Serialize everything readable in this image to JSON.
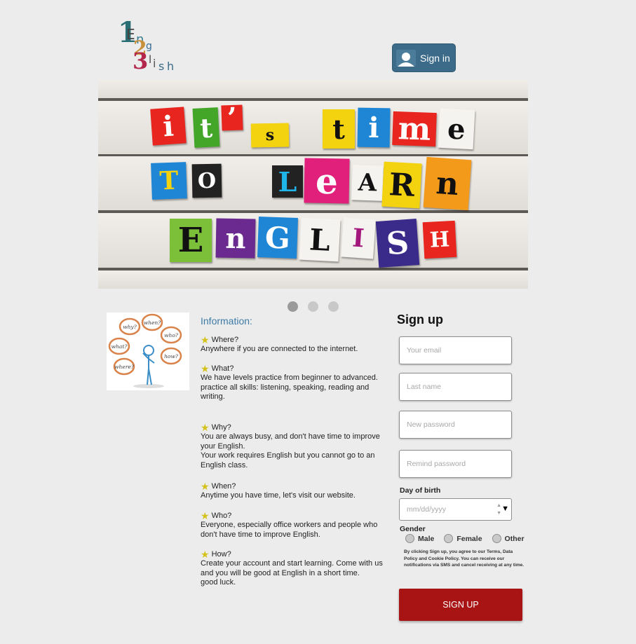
{
  "logo": {
    "alt_glyphs": [
      "1",
      "2",
      "3"
    ],
    "word": "English"
  },
  "header": {
    "signin_label": "Sign in"
  },
  "banner": {
    "lines": [
      [
        [
          "i",
          "#e8251f",
          "#fff"
        ],
        [
          "t",
          "#44a629",
          "#fff"
        ],
        [
          "’",
          "#e8251f",
          "#fff"
        ],
        [
          "s",
          "#f3d20f",
          "#111"
        ],
        [
          "t",
          "#f3d20f",
          "#111"
        ],
        [
          "i",
          "#1f86d6",
          "#fff"
        ],
        [
          "m",
          "#e8251f",
          "#fff"
        ],
        [
          "e",
          "#f5f3f0",
          "#111"
        ]
      ],
      [
        [
          "T",
          "#1f86d6",
          "#f3d20f"
        ],
        [
          "O",
          "#222",
          "#fff"
        ],
        [
          "L",
          "#222",
          "#1fb5e8"
        ],
        [
          "e",
          "#e0207a",
          "#fff"
        ],
        [
          "A",
          "#f5f3f0",
          "#111"
        ],
        [
          "R",
          "#f3d20f",
          "#111"
        ],
        [
          "n",
          "#f39a1a",
          "#111"
        ]
      ],
      [
        [
          "E",
          "#7cc03a",
          "#111"
        ],
        [
          "n",
          "#6a2a8f",
          "#fff"
        ],
        [
          "G",
          "#1f86d6",
          "#fff"
        ],
        [
          "L",
          "#f5f3f0",
          "#111"
        ],
        [
          "I",
          "#f5f3f0",
          "#a3177d"
        ],
        [
          "S",
          "#3a2a8a",
          "#fff"
        ],
        [
          "H",
          "#e8251f",
          "#fff"
        ]
      ]
    ]
  },
  "carousel": {
    "dots": 3,
    "active": 0
  },
  "info": {
    "title": "Information:",
    "items": [
      {
        "q": "Where?",
        "a": [
          "Anywhere if you are connected to the internet."
        ]
      },
      {
        "q": "What?",
        "a": [
          "We have levels practice from beginner to advanced.",
          "practice all skills: listening, speaking, reading and writing."
        ]
      },
      {
        "q": "Why?",
        "a": [
          "You are always busy, and don't have time to improve your English.",
          "Your work requires English but you cannot go to an English class."
        ]
      },
      {
        "q": "When?",
        "a": [
          "Anytime you have time, let's visit our website."
        ]
      },
      {
        "q": "Who?",
        "a": [
          "Everyone, especially office workers and people who don't have time to improve English."
        ]
      },
      {
        "q": "How?",
        "a": [
          "Create your account and start learning. Come with us and you will be good at English in a short time.",
          "good luck."
        ]
      }
    ],
    "bubbles": [
      "why?",
      "when?",
      "who?",
      "what?",
      "how?",
      "where?"
    ]
  },
  "signup": {
    "title": "Sign up",
    "email_placeholder": "Your email",
    "lastname_placeholder": "Last name",
    "password_placeholder": "New password",
    "remind_placeholder": "Remind password",
    "dob_label": "Day of birth",
    "dob_placeholder": "mm/dd/yyyy",
    "gender_label": "Gender",
    "gender_options": [
      "Male",
      "Female",
      "Other"
    ],
    "terms": "By clicking Sign up, you agree to our Terms, Data Policy and Cookie Policy. You can receive our notifications via SMS and cancel receiving at any time.",
    "button_label": "SIGN UP"
  }
}
